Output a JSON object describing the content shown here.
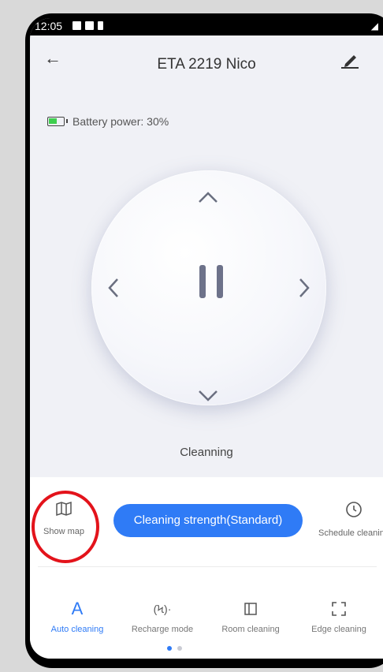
{
  "status_bar": {
    "time": "12:05",
    "signal": "◢"
  },
  "app_bar": {
    "title": "ETA 2219 Nico",
    "back_icon": "back-arrow-icon",
    "edit_icon": "edit-pen-icon"
  },
  "battery": {
    "label": "Battery power: 30%",
    "level_percent": 30,
    "color": "#3ecf4f"
  },
  "control": {
    "up": "∧",
    "down": "∨",
    "left": "<",
    "right": ">",
    "status": "Cleanning"
  },
  "actions": {
    "show_map": "Show map",
    "strength": "Cleaning strength(Standard)",
    "schedule": "Schedule cleaning",
    "accent": "#2f7bf6"
  },
  "modes": [
    {
      "label": "Auto cleaning",
      "glyph": "A",
      "active": true
    },
    {
      "label": "Recharge mode",
      "glyph": "(Ϟ)·",
      "active": false
    },
    {
      "label": "Room cleaning",
      "glyph": "",
      "active": false
    },
    {
      "label": "Edge cleaning",
      "glyph": "",
      "active": false
    }
  ],
  "pager": {
    "pages": 2,
    "current": 1
  }
}
